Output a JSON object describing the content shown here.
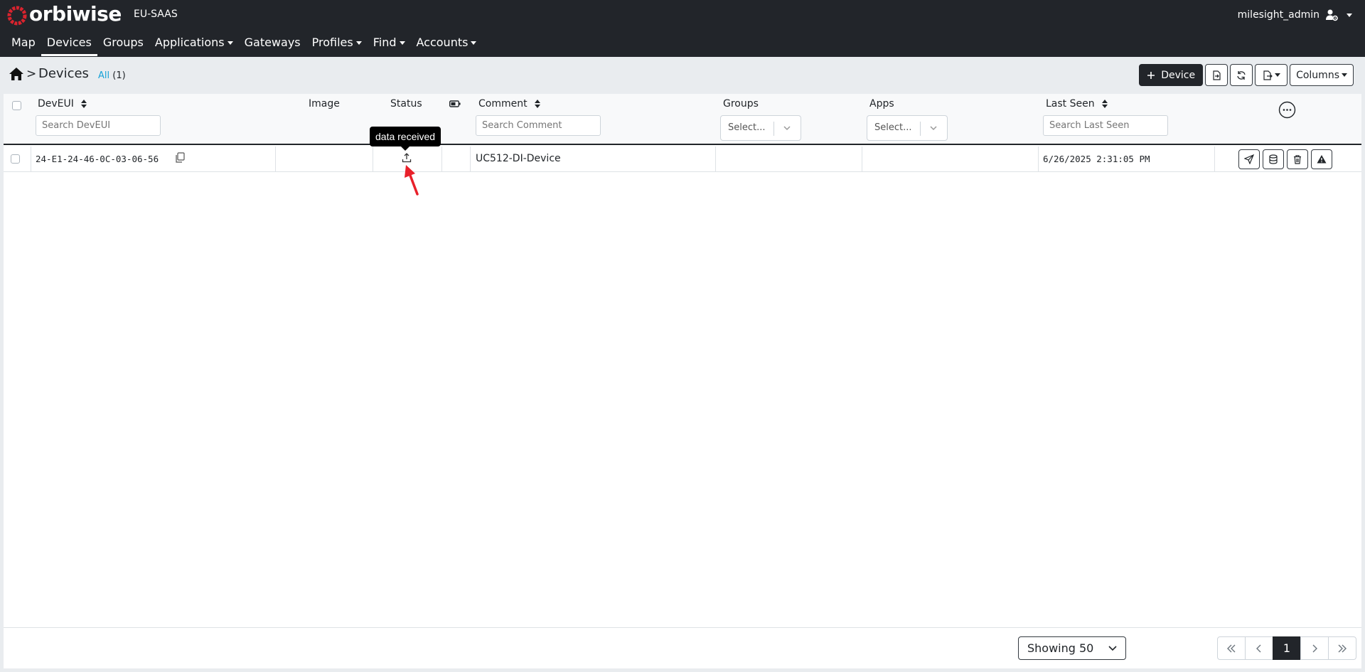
{
  "navbar": {
    "brand": "orbiwise",
    "tenant": "EU-SAAS",
    "user": "milesight_admin",
    "items": [
      {
        "label": "Map",
        "active": false,
        "dropdown": false
      },
      {
        "label": "Devices",
        "active": true,
        "dropdown": false
      },
      {
        "label": "Groups",
        "active": false,
        "dropdown": false
      },
      {
        "label": "Applications",
        "active": false,
        "dropdown": true
      },
      {
        "label": "Gateways",
        "active": false,
        "dropdown": false
      },
      {
        "label": "Profiles",
        "active": false,
        "dropdown": true
      },
      {
        "label": "Find",
        "active": false,
        "dropdown": true
      },
      {
        "label": "Accounts",
        "active": false,
        "dropdown": true
      }
    ]
  },
  "breadcrumb": {
    "separator": ">",
    "title": "Devices",
    "filter_label": "All",
    "filter_count": "(1)"
  },
  "toolbar": {
    "add_device_label": "Device",
    "columns_label": "Columns"
  },
  "table": {
    "headers": {
      "deveui": "DevEUI",
      "image": "Image",
      "status": "Status",
      "comment": "Comment",
      "groups": "Groups",
      "apps": "Apps",
      "last_seen": "Last Seen"
    },
    "placeholders": {
      "deveui": "Search DevEUI",
      "comment": "Search Comment",
      "last_seen": "Search Last Seen",
      "groups": "Select...",
      "apps": "Select..."
    },
    "rows": [
      {
        "deveui": "24-E1-24-46-0C-03-06-56",
        "image": "",
        "status_icon": "upload-icon",
        "comment": "UC512-DI-Device",
        "groups": "",
        "apps": "",
        "last_seen": "6/26/2025 2:31:05 PM"
      }
    ]
  },
  "tooltip": {
    "text": "data received"
  },
  "footer": {
    "page_size_label": "Showing 50",
    "current_page": "1"
  },
  "colors": {
    "navbar_bg": "#22252a",
    "accent_link": "#17a2d8",
    "logo_red": "#d9232e",
    "annotation_arrow": "#e8202a"
  }
}
